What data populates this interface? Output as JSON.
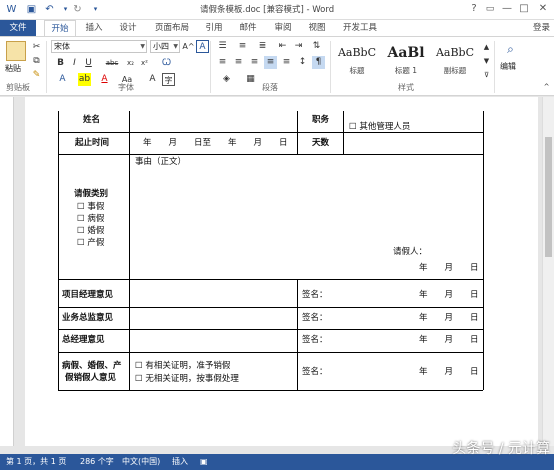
{
  "window": {
    "title": "请假条模板.doc [兼容模式] - Word",
    "controls": {
      "help": "?",
      "restore": "▭",
      "minimize": "—",
      "maximize": "□",
      "close": "✕"
    }
  },
  "quick_access": {
    "save_icon": "💾",
    "undo_icon": "↶",
    "redo_icon": "↷"
  },
  "tabs": [
    "文件",
    "开始",
    "插入",
    "设计",
    "页面布局",
    "引用",
    "邮件",
    "审阅",
    "视图",
    "开发工具"
  ],
  "active_tab": "开始",
  "login": "登录",
  "ribbon": {
    "clipboard": {
      "paste": "粘贴",
      "label": "剪贴板"
    },
    "font": {
      "name": "宋体",
      "size": "小四",
      "label": "字体"
    },
    "paragraph": {
      "label": "段落"
    },
    "styles": {
      "items": [
        {
          "sample": "AaBbC",
          "name": "标题"
        },
        {
          "sample": "AaBl",
          "name": "标题 1"
        },
        {
          "sample": "AaBbC",
          "name": "副标题"
        }
      ],
      "label": "样式"
    },
    "editing": {
      "label": "编辑"
    }
  },
  "form": {
    "name_label": "姓名",
    "position_label": "职务",
    "other_manager": "其他管理人员",
    "period_label": "起止时间",
    "period_value": "年　　月　　日至　　年　　月　　日",
    "days_label": "天数",
    "reason_text": "事由（正文）",
    "leave_type_label": "请假类别",
    "leave_types": [
      "事假",
      "病假",
      "婚假",
      "产假"
    ],
    "applicant_label": "请假人：",
    "date_line": "年　　月　　日",
    "pm_label": "项目经理意见",
    "director_label": "业务总监意见",
    "gm_label": "总经理意见",
    "special_label_1": "病假、婚假、产",
    "special_label_2": "假销假人意见",
    "cert_yes": "有相关证明，准予销假",
    "cert_no": "无相关证明，按事假处理",
    "sign_label": "签名："
  },
  "status": {
    "page": "第 1 页，共 1 页",
    "words": "286 个字",
    "lang": "中文(中国)",
    "insert": "插入"
  },
  "watermark": "头条号 / 元计算"
}
